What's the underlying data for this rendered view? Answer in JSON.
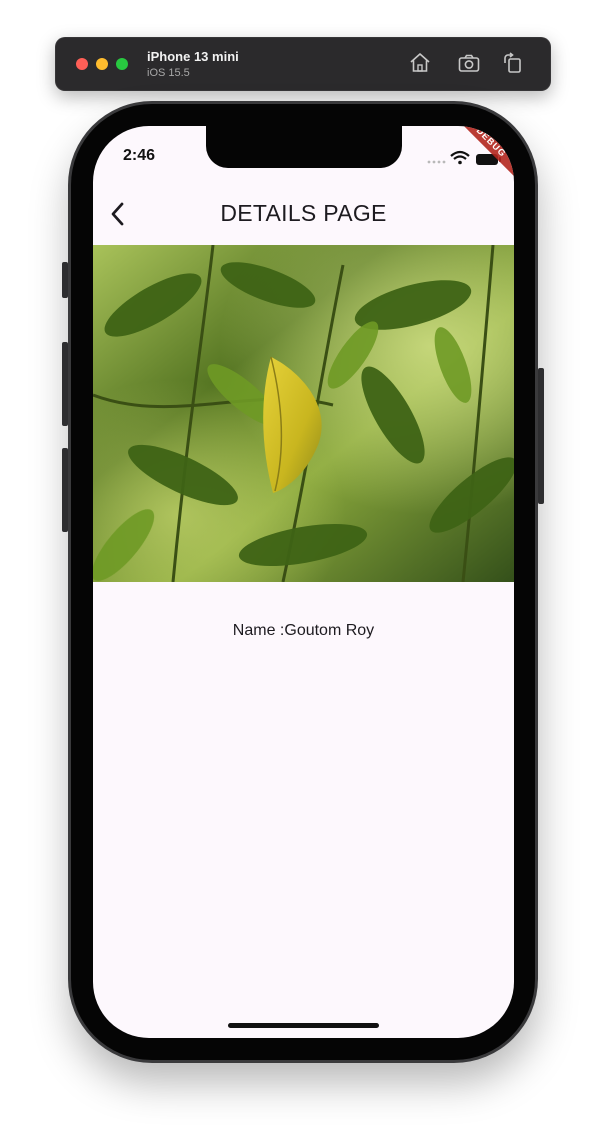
{
  "simulator": {
    "device_name": "iPhone 13 mini",
    "os_version": "iOS 15.5",
    "icons": [
      "home-icon",
      "screenshot-icon",
      "rotate-icon"
    ]
  },
  "status_bar": {
    "time": "2:46",
    "icons": [
      "signal-icon",
      "wifi-icon",
      "battery-icon"
    ]
  },
  "debug_banner": "DEBUG",
  "app_bar": {
    "title": "DETAILS PAGE",
    "back_icon": "chevron-left-icon"
  },
  "details": {
    "image_subject": "green leaves with a yellow leaf",
    "name_text": "Name :Goutom Roy"
  },
  "colors": {
    "screen_background": "#fdf8fd",
    "text": "#1d1b20",
    "debug_ribbon": "#b3261e"
  }
}
